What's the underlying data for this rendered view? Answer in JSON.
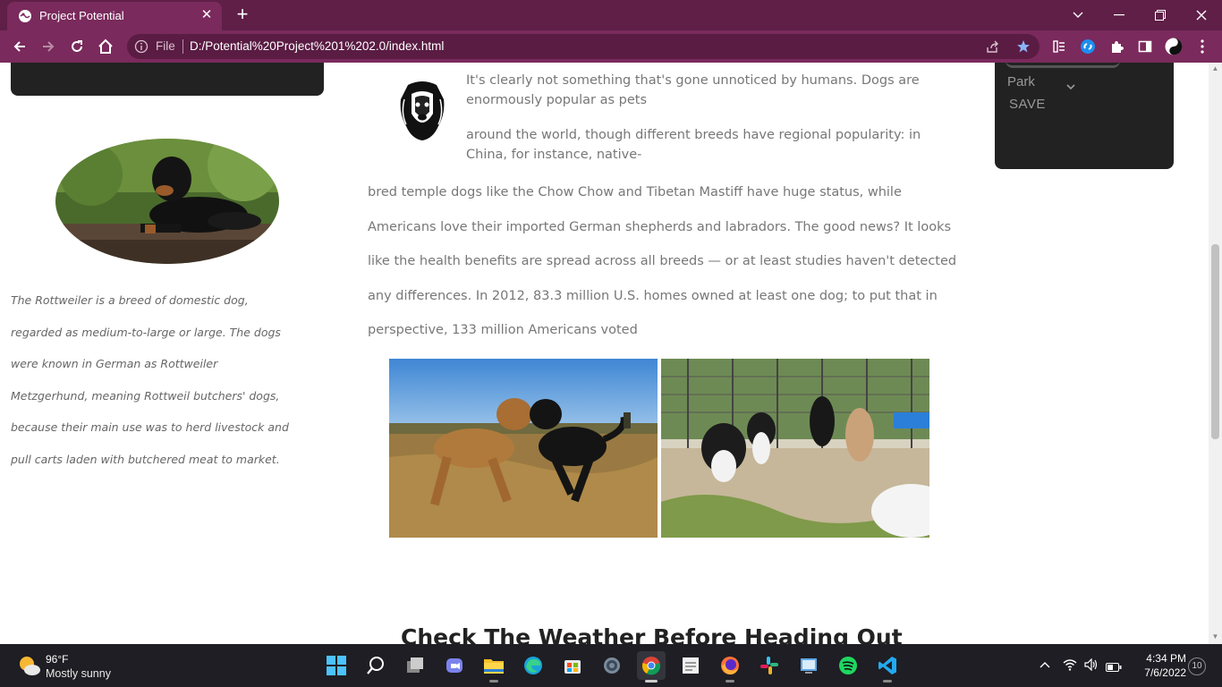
{
  "browser": {
    "tab_title": "Project Potential",
    "file_label": "File",
    "url": "D:/Potential%20Project%201%202.0/index.html"
  },
  "content": {
    "rottweiler_caption": "The Rottweiler is a breed of domestic dog, regarded as medium-to-large or large. The dogs were known in German as Rottweiler Metzgerhund, meaning Rottweil butchers' dogs, because their main use was to herd livestock and pull carts laden with butchered meat to market.",
    "para1": "It's clearly not something that's gone unnoticed by humans. Dogs are enormously popular as pets",
    "para2": "around the world, though different breeds have regional popularity: in China, for instance, native-",
    "para3": "bred temple dogs like the Chow Chow and Tibetan Mastiff have huge status, while Americans love their imported German shepherds and labradors. The good news? It looks like the health benefits are spread across all breeds — or at least studies haven't detected any differences. In 2012, 83.3 million U.S. homes owned at least one dog; to put that in perspective, 133 million Americans voted",
    "weather_heading": "Check The Weather Before Heading Out"
  },
  "sidebar_right": {
    "select_value": "Park",
    "save_label": "SAVE"
  },
  "taskbar": {
    "weather_temp": "96°F",
    "weather_desc": "Mostly sunny",
    "time": "4:34 PM",
    "date": "7/6/2022",
    "notifications": "10"
  },
  "colors": {
    "browser_frame": "#5f1f47",
    "toolbar": "#7a2a5c",
    "dark_box": "#222222",
    "taskbar": "#1e1e24"
  }
}
